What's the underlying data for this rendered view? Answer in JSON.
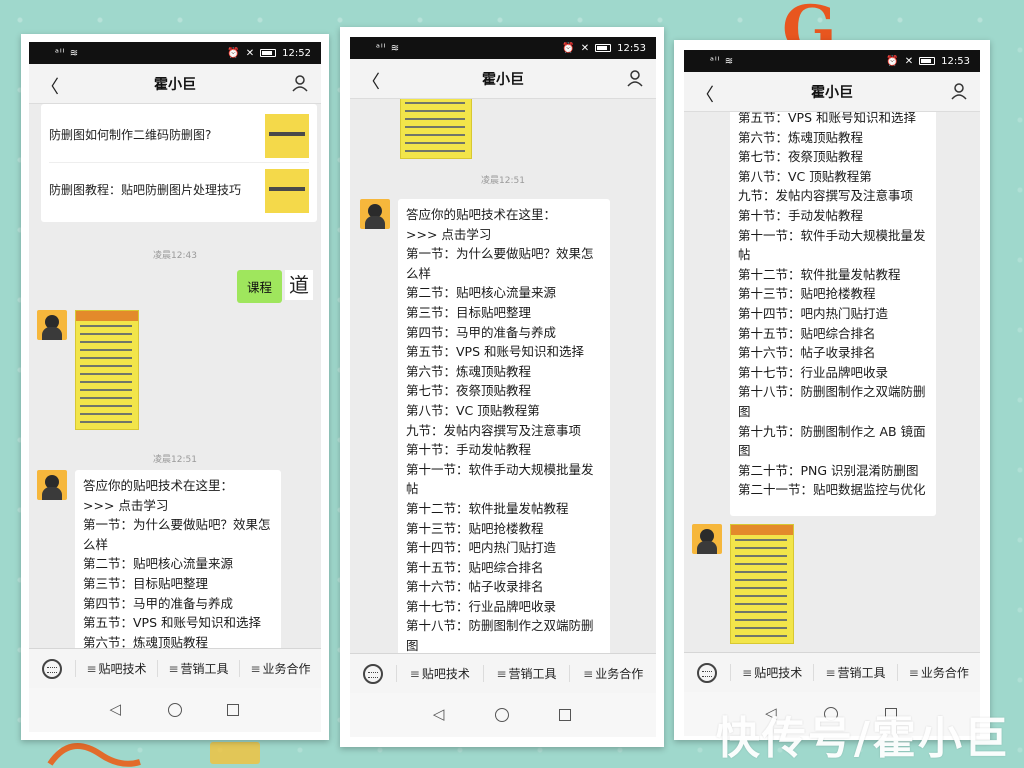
{
  "watermark": "快传号/霍小巨",
  "deco_letter": "G",
  "phones": [
    {
      "status_time": "12:52",
      "title": "霍小巨",
      "cards": [
        "防删图如何制作二维码防删图?",
        "防删图教程：贴吧防删图片处理技巧"
      ],
      "timestamps": [
        "凌晨12:43",
        "凌晨12:51"
      ],
      "sent_text": "课程",
      "sent_avatar_char": "道",
      "message_lines": [
        "答应你的贴吧技术在这里：",
        ">>> 点击学习",
        "第一节：为什么要做贴吧？效果怎",
        "么样",
        "第二节：贴吧核心流量来源",
        "第三节：目标贴吧整理",
        "第四节：马甲的准备与养成",
        "第五节：VPS 和账号知识和选择",
        "第六节：炼魂顶贴教程"
      ],
      "menu": [
        "贴吧技术",
        "营销工具",
        "业务合作"
      ]
    },
    {
      "status_time": "12:53",
      "title": "霍小巨",
      "timestamps": [
        "凌晨12:51"
      ],
      "message_lines": [
        "答应你的贴吧技术在这里：",
        ">>> 点击学习",
        "第一节：为什么要做贴吧？效果怎",
        "么样",
        "第二节：贴吧核心流量来源",
        "第三节：目标贴吧整理",
        "第四节：马甲的准备与养成",
        "第五节：VPS 和账号知识和选择",
        "第六节：炼魂顶贴教程",
        "第七节：夜祭顶贴教程",
        "第八节：VC 顶贴教程第",
        "九节：发帖内容撰写及注意事项",
        "第十节：手动发帖教程",
        "第十一节：软件手动大规模批量发",
        "帖",
        "第十二节：软件批量发帖教程",
        "第十三节：贴吧抢楼教程",
        "第十四节：吧内热门贴打造",
        "第十五节：贴吧综合排名",
        "第十六节：帖子收录排名",
        "第十七节：行业品牌吧收录",
        "第十八节：防删图制作之双端防删",
        "图"
      ],
      "menu": [
        "贴吧技术",
        "营销工具",
        "业务合作"
      ]
    },
    {
      "status_time": "12:53",
      "title": "霍小巨",
      "message_lines": [
        "第五节：VPS 和账号知识和选择",
        "第六节：炼魂顶贴教程",
        "第七节：夜祭顶贴教程",
        "第八节：VC 顶贴教程第",
        "九节：发帖内容撰写及注意事项",
        "第十节：手动发帖教程",
        "第十一节：软件手动大规模批量发",
        "帖",
        "第十二节：软件批量发帖教程",
        "第十三节：贴吧抢楼教程",
        "第十四节：吧内热门贴打造",
        "第十五节：贴吧综合排名",
        "第十六节：帖子收录排名",
        "第十七节：行业品牌吧收录",
        "第十八节：防删图制作之双端防删",
        "图",
        "第十九节：防删图制作之 AB 镜面",
        "图",
        "第二十节：PNG 识别混淆防删图",
        "第二十一节：贴吧数据监控与优化"
      ],
      "menu": [
        "贴吧技术",
        "营销工具",
        "业务合作"
      ]
    }
  ]
}
